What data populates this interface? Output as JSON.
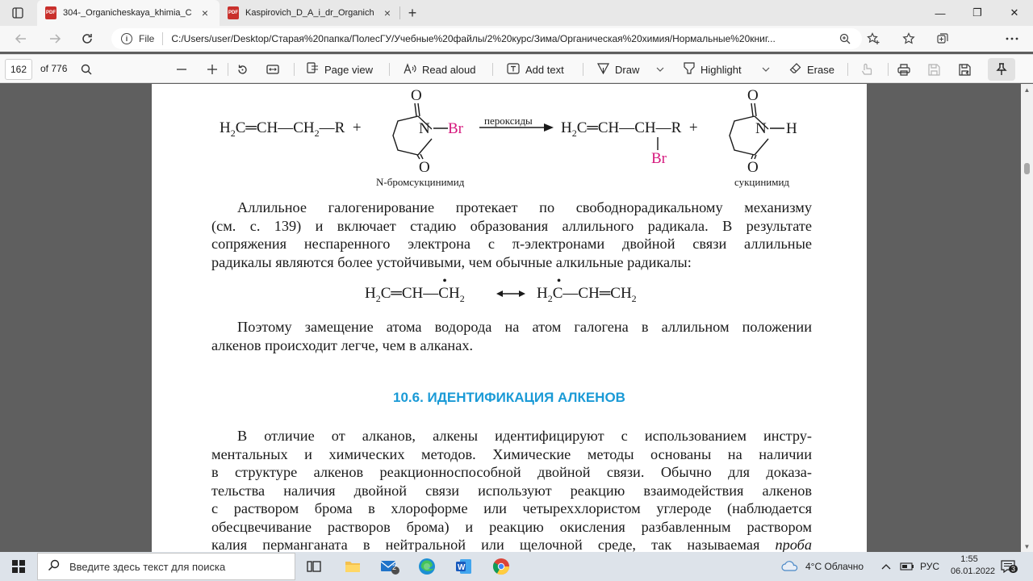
{
  "tabs": [
    {
      "title": "304-_Organicheskaya_khimia_Ch",
      "icon": "pdf-icon",
      "icon_text": "PDF",
      "active": true
    },
    {
      "title": "Kaspirovich_D_A_i_dr_Organiche",
      "icon": "pdf-icon",
      "icon_text": "PDF",
      "active": false
    }
  ],
  "tab_close": "×",
  "new_tab": "+",
  "window_controls": {
    "minimize": "—",
    "maximize": "❐",
    "close": "✕"
  },
  "address_bar": {
    "info": "i",
    "scheme_label": "File",
    "url": "C:/Users/user/Desktop/Старая%20папка/ПолесГУ/Учебные%20файлы/2%20курс/Зима/Органическая%20химия/Нормальные%20книг..."
  },
  "pdf_toolbar": {
    "page_number": "162",
    "page_of": "of 776",
    "page_view": "Page view",
    "read_aloud": "Read aloud",
    "add_text": "Add text",
    "draw": "Draw",
    "highlight": "Highlight",
    "erase": "Erase"
  },
  "document": {
    "reagent_label": "N-бромсукцинимид",
    "arrow_label": "пероксиды",
    "product_label": "сукцинимид",
    "paragraph1": [
      "Аллильное галогенирование протекает по свободнорадикальному механизму",
      "(см. с. 139) и включает стадию образования аллильного радикала. В результате",
      "сопряжения неспаренного электрона с π-электронами двойной связи аллильные",
      "радикалы являются более устойчивыми, чем обычные алкильные радикалы:"
    ],
    "paragraph2": [
      "Поэтому замещение атома водорода на атом галогена в аллильном положении",
      "алкенов происходит легче, чем в алканах."
    ],
    "section_title": "10.6. ИДЕНТИФИКАЦИЯ АЛКЕНОВ",
    "paragraph3": [
      "В отличие от алканов, алкены идентифицируют с использованием инстру-",
      "ментальных и химических методов. Химические методы основаны на наличии",
      "в структуре алкенов реакционноспособной двойной связи. Обычно для доказа-",
      "тельства наличия двойной связи используют реакцию взаимодействия алкенов",
      "с раствором брома в хлороформе или четыреххлористом углероде (наблюдается",
      "обесцвечивание растворов брома) и реакцию окисления разбавленным раствором",
      "калия перманганата в нейтральной или щелочной среде, так называемая"
    ],
    "paragraph3_italic_end": "проба",
    "colors": {
      "bromine": "#d6187d",
      "section_title": "#1a9ad6"
    }
  },
  "taskbar": {
    "search_placeholder": "Введите здесь текст для поиска",
    "mail_badge": "2",
    "weather": "4°C  Облачно",
    "language": "РУС",
    "time": "1:55",
    "date": "06.01.2022",
    "notification_count": "3"
  }
}
